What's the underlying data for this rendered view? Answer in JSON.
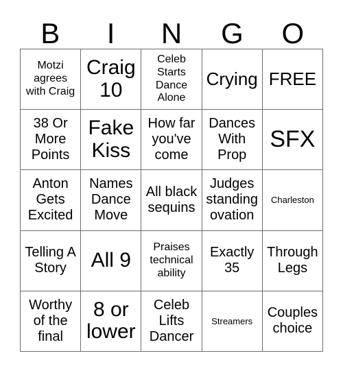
{
  "card": {
    "title_letters": [
      "B",
      "I",
      "N",
      "G",
      "O"
    ],
    "columns": 5,
    "rows": 5,
    "text_color": "#000000",
    "background_color": "#ffffff",
    "border_color": "#6d6d6d",
    "free_space_label": "FREE"
  },
  "cells": [
    {
      "text": "Motzi agrees with Craig",
      "size": "sm"
    },
    {
      "text": "Craig 10",
      "size": "xl"
    },
    {
      "text": "Celeb Starts Dance Alone",
      "size": "sm"
    },
    {
      "text": "Crying",
      "size": "lg"
    },
    {
      "text": "FREE",
      "size": "lg"
    },
    {
      "text": "38 Or More Points",
      "size": "md"
    },
    {
      "text": "Fake Kiss",
      "size": "xl"
    },
    {
      "text": "How far you've come",
      "size": "md"
    },
    {
      "text": "Dances With Prop",
      "size": "md"
    },
    {
      "text": "SFX",
      "size": "xxl"
    },
    {
      "text": "Anton Gets Excited",
      "size": "md"
    },
    {
      "text": "Names Dance Move",
      "size": "md"
    },
    {
      "text": "All black sequins",
      "size": "md"
    },
    {
      "text": "Judges standing ovation",
      "size": "md"
    },
    {
      "text": "Charleston",
      "size": "xs"
    },
    {
      "text": "Telling A Story",
      "size": "md"
    },
    {
      "text": "All 9",
      "size": "xl"
    },
    {
      "text": "Praises technical ability",
      "size": "sm"
    },
    {
      "text": "Exactly 35",
      "size": "md"
    },
    {
      "text": "Through Legs",
      "size": "md"
    },
    {
      "text": "Worthy of the final",
      "size": "md"
    },
    {
      "text": "8 or lower",
      "size": "xl"
    },
    {
      "text": "Celeb Lifts Dancer",
      "size": "md"
    },
    {
      "text": "Streamers",
      "size": "xs"
    },
    {
      "text": "Couples choice",
      "size": "md"
    }
  ]
}
